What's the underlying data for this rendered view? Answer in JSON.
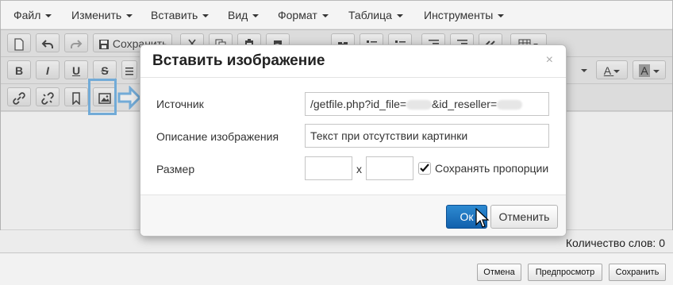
{
  "menubar": {
    "items": [
      "Файл",
      "Изменить",
      "Вставить",
      "Вид",
      "Формат",
      "Таблица",
      "Инструменты"
    ]
  },
  "toolbar": {
    "save_label": "Сохранить"
  },
  "icons": {
    "bold": "B",
    "italic": "I",
    "underline": "U",
    "strikethrough": "S",
    "text_color": "A",
    "bg_color": "A"
  },
  "status": {
    "word_count": "Количество слов: 0"
  },
  "bottom_buttons": {
    "cancel": "Отмена",
    "preview": "Предпросмотр",
    "save": "Сохранить"
  },
  "dialog": {
    "title": "Вставить изображение",
    "close": "×",
    "source_label": "Источник",
    "source_prefix": "/getfile.php?id_file=",
    "source_suffix": "&id_reseller=",
    "description_label": "Описание изображения",
    "description_value": "Текст при отсутствии картинки",
    "size_label": "Размер",
    "size_separator": "x",
    "keep_proportions_label": "Сохранять пропорции",
    "keep_proportions_checked": true,
    "ok": "Ок",
    "cancel": "Отменить"
  },
  "colors": {
    "accent": "#1a70bd",
    "highlight": "#6bb0e6"
  }
}
